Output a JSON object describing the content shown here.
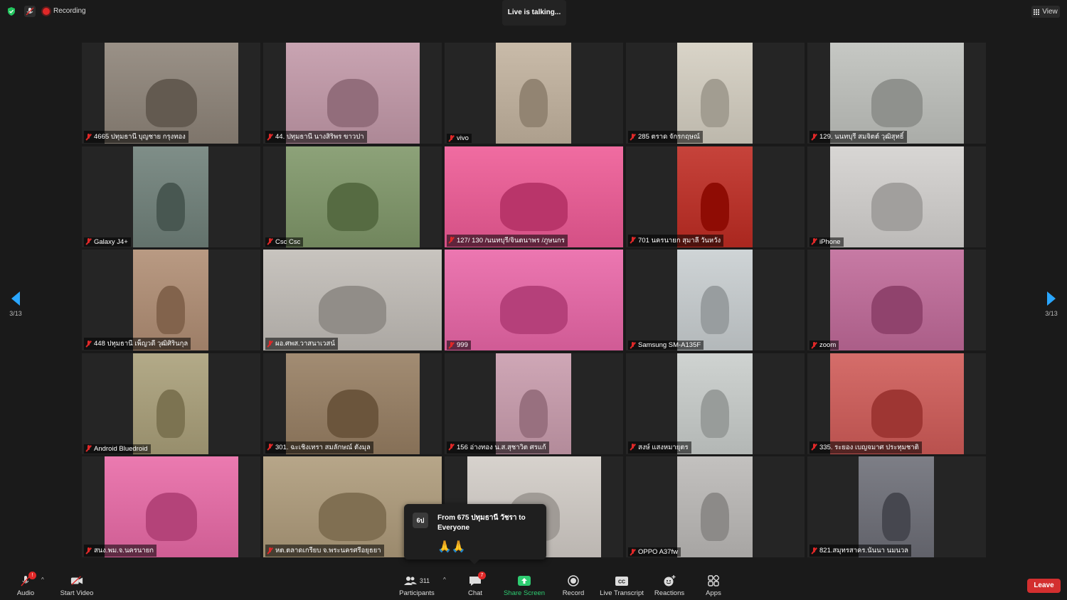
{
  "top_bar": {
    "security_icon": "shield-check-icon",
    "recording_label": "Recording",
    "speaker_status": "Live is talking...",
    "view_label": "View"
  },
  "pagination": {
    "left": "3/13",
    "right": "3/13"
  },
  "participants": [
    {
      "name": "4665 ปทุมธานี บุญชาย กรุงทอง",
      "video_color": "#9a9187"
    },
    {
      "name": "44. ปทุมธานี นางสิริพร ขาวปา",
      "video_color": "#c9a4b2"
    },
    {
      "name": "vivo",
      "video_color": "#c9bba9"
    },
    {
      "name": "285 ตราด จักรกฤษณ์",
      "video_color": "#d9d4c8"
    },
    {
      "name": "129. นนทบุรี สมจิตต์ วุฒิสุทธิ์",
      "video_color": "#c6c8c4"
    },
    {
      "name": "Galaxy J4+",
      "video_color": "#7f8e88"
    },
    {
      "name": "Csc Csc",
      "video_color": "#8da279"
    },
    {
      "name": "127/ 130 /นนทบุรี/จินตนาพร /ภูษนกร",
      "video_color": "#f06ca1"
    },
    {
      "name": "701 นครนายก สุมาลี วันหวัง",
      "video_color": "#c6433b"
    },
    {
      "name": "iPhone",
      "video_color": "#d8d6d4"
    },
    {
      "name": "448 ปทุมธานี เพ็ญวดี วุฒิศิรินกุล",
      "video_color": "#b99a83"
    },
    {
      "name": "ผอ.ศพส.วาสนาเวสน์",
      "video_color": "#c8c4bf"
    },
    {
      "name": "999",
      "video_color": "#ec77b1"
    },
    {
      "name": "Samsung SM-A135F",
      "video_color": "#cfd4d6"
    },
    {
      "name": "zoom",
      "video_color": "#c77aa4"
    },
    {
      "name": "Android Bluedroid",
      "video_color": "#b3aa88"
    },
    {
      "name": "301. ฉะเชิงเทรา สมลักษณ์ ตังมุล",
      "video_color": "#a28c73"
    },
    {
      "name": "156 อ่างทอง น.ส.สุชาวิต ศรแก้",
      "video_color": "#cfa7b6"
    },
    {
      "name": "สงษ์ แสงหมายุตร",
      "video_color": "#cfd3d1"
    },
    {
      "name": "335. ระยอง เบญจมาศ ประทุมชาติ",
      "video_color": "#d56d6a"
    },
    {
      "name": "สนง.พม.จ.นครนายก",
      "video_color": "#eb7ab0"
    },
    {
      "name": "หต.ตลาดเกรียบ จ.พระนครศรีอยุธยา",
      "video_color": "#b7a689"
    },
    {
      "name": "",
      "video_color": "#d7d2cd"
    },
    {
      "name": "OPPO A37fw",
      "video_color": "#c3c1bf"
    },
    {
      "name": "821.สมุทรสาคร.นันนา นมนวล",
      "video_color": "#7d7e86"
    }
  ],
  "chat_popup": {
    "avatar_text": "6ป",
    "from_line": "From 675 ปทุมธานี วัชรา to Everyone",
    "message": "🙏🙏"
  },
  "toolbar": {
    "audio": "Audio",
    "audio_badge": "!",
    "start_video": "Start Video",
    "participants": "Participants",
    "participants_count": "311",
    "chat": "Chat",
    "chat_badge": "7",
    "share_screen": "Share Screen",
    "record": "Record",
    "live_transcript": "Live Transcript",
    "reactions": "Reactions",
    "apps": "Apps",
    "leave": "Leave"
  },
  "colors": {
    "background": "#1a1a1a",
    "accent_blue": "#2aa6ff",
    "share_green": "#2ecc71",
    "danger_red": "#d32f2f"
  }
}
